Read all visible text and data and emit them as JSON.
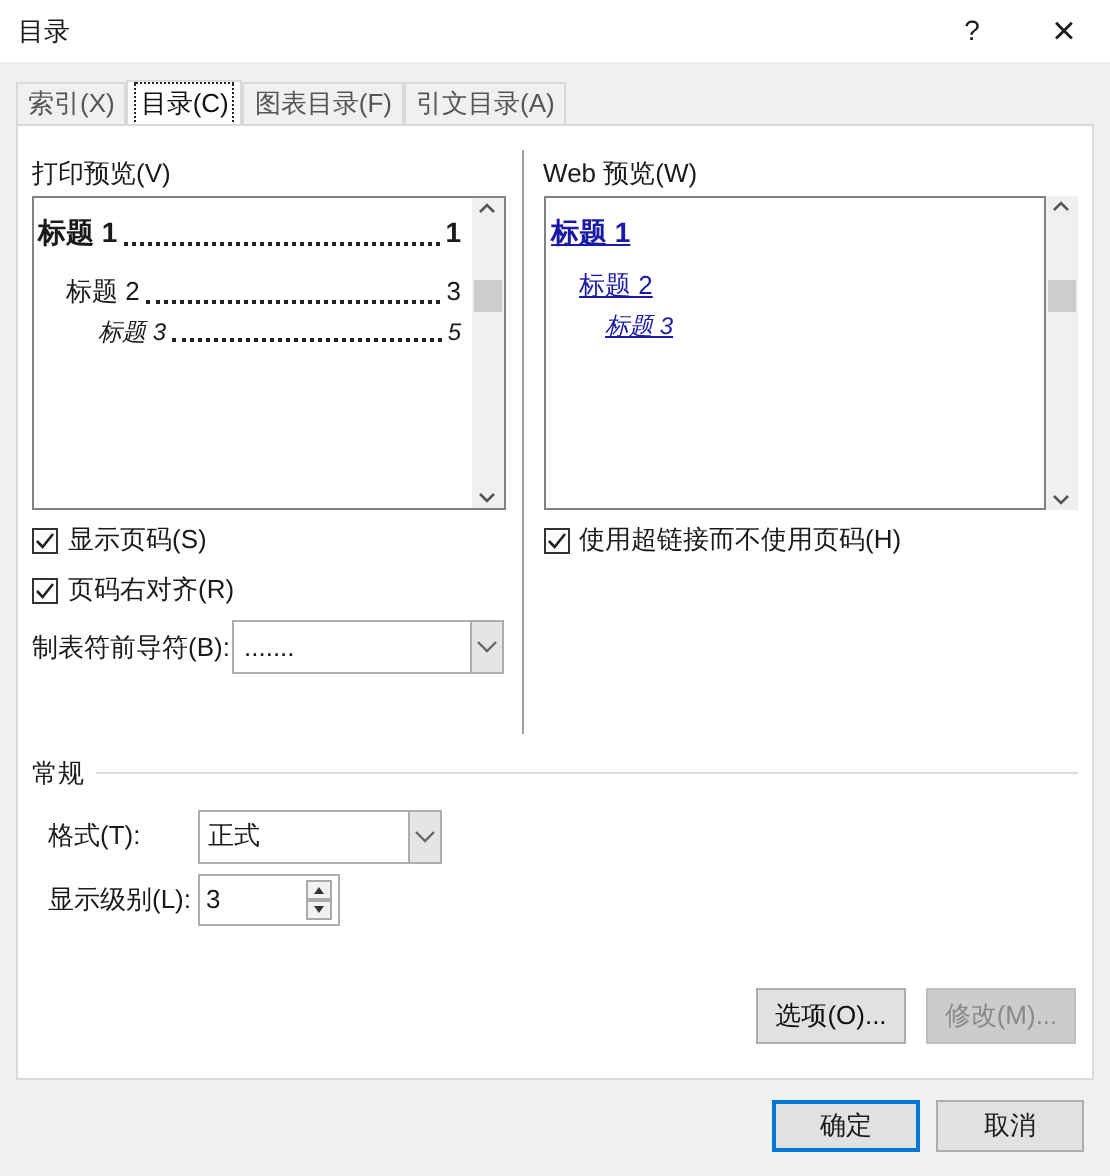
{
  "window": {
    "title": "目录",
    "help": "?",
    "close": "×"
  },
  "tabs": [
    {
      "label": "索引(X)",
      "selected": false
    },
    {
      "label": "目录(C)",
      "selected": true
    },
    {
      "label": "图表目录(F)",
      "selected": false
    },
    {
      "label": "引文目录(A)",
      "selected": false
    }
  ],
  "print_preview": {
    "label": "打印预览(V)",
    "entries": [
      {
        "text": "标题 1",
        "page": "1",
        "kind": "heading1"
      },
      {
        "text": "标题 2",
        "page": "3",
        "kind": "heading2"
      },
      {
        "text": "标题 3",
        "page": "5",
        "kind": "heading3"
      }
    ]
  },
  "web_preview": {
    "label": "Web 预览(W)",
    "entries": [
      {
        "text": "标题 1",
        "kind": "heading1"
      },
      {
        "text": "标题 2",
        "kind": "heading2"
      },
      {
        "text": "标题 3",
        "kind": "heading3"
      }
    ]
  },
  "options": [
    {
      "label": "显示页码(S)",
      "checked": true
    },
    {
      "label": "页码右对齐(R)",
      "checked": true
    }
  ],
  "web_option": {
    "label": "使用超链接而不使用页码(H)",
    "checked": true
  },
  "tab_leader": {
    "label": "制表符前导符(B):",
    "value": "......."
  },
  "general": {
    "title": "常规",
    "format": {
      "label": "格式(T):",
      "value": "正式"
    },
    "levels": {
      "label": "显示级别(L):",
      "value": "3"
    }
  },
  "buttons": [
    {
      "label": "选项(O)...",
      "disabled": false
    },
    {
      "label": "修改(M)...",
      "disabled": true
    }
  ],
  "footer_buttons": [
    {
      "label": "确定",
      "default": true
    },
    {
      "label": "取消",
      "default": false
    }
  ]
}
